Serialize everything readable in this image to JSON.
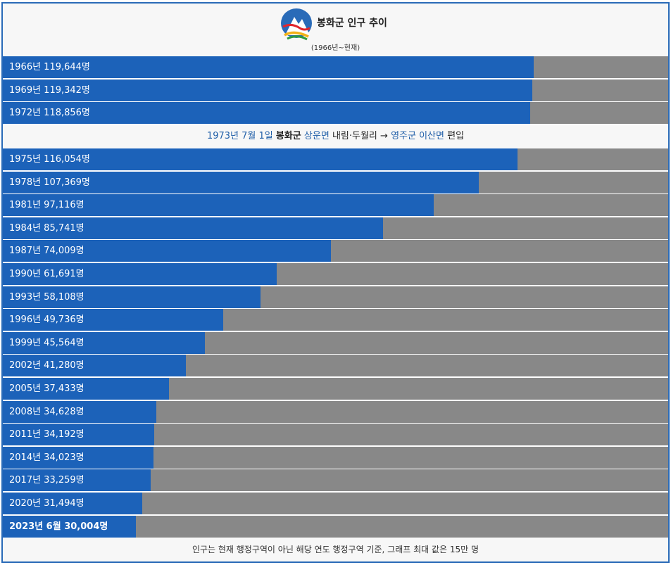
{
  "header": {
    "title": "봉화군 인구 추이",
    "subtitle": "(1966년~현재)",
    "logo_icon": "bonghwa-county-emblem-icon"
  },
  "note": {
    "date": "1973년 7월 1일",
    "county": "봉화군",
    "from_area": "상운면",
    "villages": "내림·두월리",
    "arrow": "→",
    "to_county": "영주군",
    "to_area": "이산면",
    "action": "편입"
  },
  "footer": {
    "text": "인구는 현재 행정구역이 아닌 해당 연도 행정구역 기준, 그래프 최대 값은 15만 명"
  },
  "colors": {
    "bar": "#1c62b9",
    "track": "#888888",
    "border": "#2a6bb8",
    "link": "#1f5ea8"
  },
  "chart_data": {
    "type": "bar",
    "orientation": "horizontal",
    "xlim": [
      0,
      150000
    ],
    "rows": [
      {
        "label": "1966년 119,644명",
        "value": 119644
      },
      {
        "label": "1969년 119,342명",
        "value": 119342
      },
      {
        "label": "1972년 118,856명",
        "value": 118856
      },
      {
        "label": "1975년 116,054명",
        "value": 116054
      },
      {
        "label": "1978년 107,369명",
        "value": 107369
      },
      {
        "label": "1981년 97,116명",
        "value": 97116
      },
      {
        "label": "1984년 85,741명",
        "value": 85741
      },
      {
        "label": "1987년 74,009명",
        "value": 74009
      },
      {
        "label": "1990년 61,691명",
        "value": 61691
      },
      {
        "label": "1993년 58,108명",
        "value": 58108
      },
      {
        "label": "1996년 49,736명",
        "value": 49736
      },
      {
        "label": "1999년 45,564명",
        "value": 45564
      },
      {
        "label": "2002년 41,280명",
        "value": 41280
      },
      {
        "label": "2005년 37,433명",
        "value": 37433
      },
      {
        "label": "2008년 34,628명",
        "value": 34628
      },
      {
        "label": "2011년 34,192명",
        "value": 34192
      },
      {
        "label": "2014년 34,023명",
        "value": 34023
      },
      {
        "label": "2017년 33,259명",
        "value": 33259
      },
      {
        "label": "2020년 31,494명",
        "value": 31494
      },
      {
        "label": "2023년 6월 30,004명",
        "value": 30004,
        "bold": true
      }
    ]
  }
}
